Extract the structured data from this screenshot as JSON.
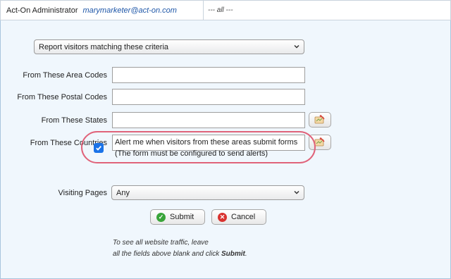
{
  "header": {
    "user_label": "Act-On Administrator",
    "email": "marymarketer@act-on.com",
    "filter_text": "--- all ---"
  },
  "form": {
    "mode_select": {
      "value": "Report visitors matching these criteria"
    },
    "fields": [
      {
        "label": "From These Area Codes",
        "value": ""
      },
      {
        "label": "From These Postal Codes",
        "value": ""
      },
      {
        "label": "From These States",
        "value": ""
      },
      {
        "label": "From These Countries",
        "value": ""
      }
    ],
    "alert": {
      "checked": true,
      "line1": "Alert me when visitors from these areas submit forms",
      "line2": "(The form must be configured to send alerts)"
    },
    "visiting_pages": {
      "label": "Visiting Pages",
      "value": "Any"
    },
    "buttons": {
      "submit": "Submit",
      "cancel": "Cancel"
    },
    "note": {
      "line1": "To see all website traffic, leave",
      "line2_prefix": "all the fields above blank and click ",
      "line2_bold": "Submit",
      "line2_suffix": "."
    }
  },
  "colors": {
    "email": "#1f57a8",
    "panel_bg": "#f0f7fd",
    "checkbox": "#1a73e8",
    "highlight": "#e0637a",
    "submit_icon": "#3aa53a",
    "cancel_icon": "#d9322f"
  }
}
